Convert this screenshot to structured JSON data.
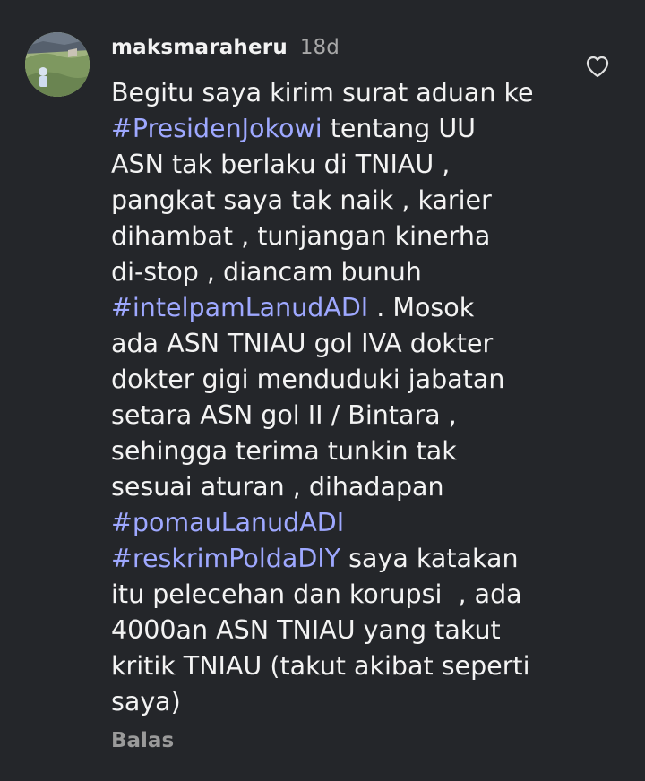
{
  "comment": {
    "username": "maksmaraheru",
    "time": "18d",
    "lines": [
      [
        {
          "t": "Begitu saya kirim surat aduan ke",
          "h": false
        }
      ],
      [
        {
          "t": "#PresidenJokowi",
          "h": true
        },
        {
          "t": " tentang UU",
          "h": false
        }
      ],
      [
        {
          "t": "ASN tak berlaku di TNIAU ,",
          "h": false
        }
      ],
      [
        {
          "t": "pangkat saya tak naik , karier",
          "h": false
        }
      ],
      [
        {
          "t": "dihambat , tunjangan kinerha",
          "h": false
        }
      ],
      [
        {
          "t": "di-stop , diancam bunuh",
          "h": false
        }
      ],
      [
        {
          "t": "#intelpamLanudADI",
          "h": true
        },
        {
          "t": " . Mosok",
          "h": false
        }
      ],
      [
        {
          "t": "ada ASN TNIAU gol IVA dokter",
          "h": false
        }
      ],
      [
        {
          "t": "dokter gigi menduduki jabatan",
          "h": false
        }
      ],
      [
        {
          "t": "setara ASN gol II / Bintara ,",
          "h": false
        }
      ],
      [
        {
          "t": "sehingga terima tunkin tak",
          "h": false
        }
      ],
      [
        {
          "t": "sesuai aturan , dihadapan",
          "h": false
        }
      ],
      [
        {
          "t": "#pomauLanudADI",
          "h": true
        }
      ],
      [
        {
          "t": "#reskrimPoldaDIY",
          "h": true
        },
        {
          "t": " saya katakan",
          "h": false
        }
      ],
      [
        {
          "t": "itu pelecehan dan korupsi  , ada",
          "h": false
        }
      ],
      [
        {
          "t": "4000an ASN TNIAU yang takut",
          "h": false
        }
      ],
      [
        {
          "t": "kritik TNIAU (takut akibat seperti",
          "h": false
        }
      ],
      [
        {
          "t": "saya)",
          "h": false
        }
      ]
    ],
    "reply_label": "Balas",
    "like_icon": "heart-outline-icon",
    "avatar_icon": "profile-photo"
  },
  "colors": {
    "background": "#24262a",
    "text": "#f3f3f3",
    "hashtag": "#9ea8ff",
    "muted": "#a8a8a8",
    "reply": "#9a9a9a"
  }
}
